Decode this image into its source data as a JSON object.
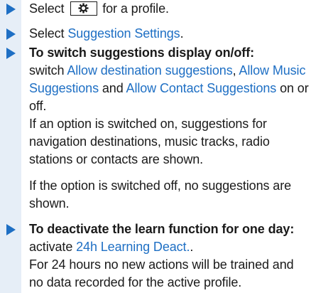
{
  "steps": [
    {
      "pre": "Select",
      "icon": "gear-icon",
      "post": "for a profile."
    },
    {
      "pre": "Select",
      "link": "Suggestion Settings",
      "post": "."
    },
    {
      "heading": "To switch suggestions display on/off:",
      "pre": "switch",
      "link1": "Allow destination suggestions",
      "sep1": ",",
      "link2": "Allow Music Suggestions",
      "sep2": "and",
      "link3": "Allow Contact Suggestions",
      "post": "on or off.",
      "para1": "If an option is switched on, suggestions for navigation destinations, music tracks, radio stations or contacts are shown.",
      "para2": "If the option is switched off, no suggestions are shown."
    },
    {
      "heading": "To deactivate the learn function for one day:",
      "pre": "activate",
      "link": "24h Learning Deact.",
      "post": ".",
      "para1": "For 24 hours no new actions will be trained and no data recorded for the active profile."
    }
  ],
  "colors": {
    "accent": "#1e6fc4",
    "bar": "#e6eef7",
    "text": "#1a1a1a"
  }
}
